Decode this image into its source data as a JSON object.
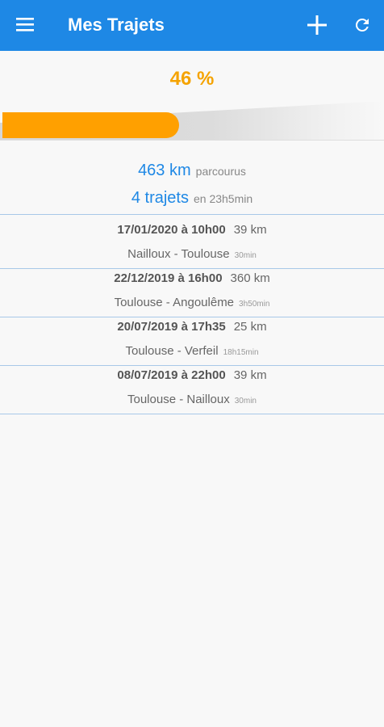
{
  "appbar": {
    "title": "Mes Trajets",
    "menu_icon": "hamburger-menu-icon",
    "add_icon": "plus-icon",
    "refresh_icon": "refresh-icon",
    "color": "#1e88e5"
  },
  "progress": {
    "label": "46 %",
    "value": 0.46,
    "color": "#ffa000"
  },
  "summary": {
    "distance": "463 km",
    "distance_suffix": "parcourus",
    "trips": "4 trajets",
    "trips_suffix": "en 23h5min"
  },
  "trips": [
    {
      "date": "17/01/2020 à 10h00",
      "km": "39 km",
      "route": "Nailloux - Toulouse",
      "duration": "30min"
    },
    {
      "date": "22/12/2019 à 16h00",
      "km": "360 km",
      "route": "Toulouse  - Angoulême",
      "duration": "3h50min"
    },
    {
      "date": "20/07/2019 à 17h35",
      "km": "25 km",
      "route": "Toulouse  - Verfeil",
      "duration": "18h15min"
    },
    {
      "date": "08/07/2019 à 22h00",
      "km": "39 km",
      "route": "Toulouse - Nailloux",
      "duration": "30min"
    }
  ]
}
